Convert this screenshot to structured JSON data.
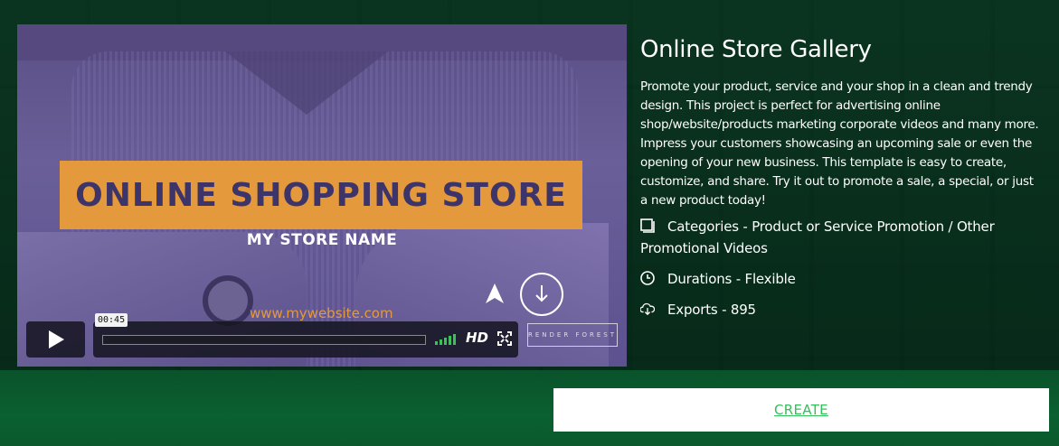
{
  "video": {
    "banner_title": "ONLINE SHOPPING STORE",
    "store_name": "MY STORE NAME",
    "website": "www.mywebsite.com",
    "time_tooltip": "00:45",
    "hd_label": "HD",
    "logo_text": "RENDER FOREST",
    "progress": 0
  },
  "info": {
    "title": "Online Store Gallery",
    "description": "Promote your product, service and your shop in a clean and trendy design. This project is perfect for advertising online shop/website/products marketing corporate videos and many more. Impress your customers showcasing an upcoming sale or even the opening of your new business. This template is easy to create, customize, and share. Try it out to promote a sale, a special, or just a new product today!",
    "categories": "Categories - Product or Service Promotion / Other Promotional Videos",
    "durations": "Durations - Flexible",
    "exports": "Exports - 895"
  },
  "actions": {
    "create_label": "CREATE"
  },
  "colors": {
    "accent_green": "#33c05a",
    "banner_orange": "#e49a3c",
    "video_purple": "#5d5290"
  },
  "icons": [
    "play-icon",
    "fullscreen-icon",
    "navigation-arrow-icon",
    "download-arrow-icon",
    "copy-icon",
    "clock-icon",
    "cloud-download-icon"
  ]
}
